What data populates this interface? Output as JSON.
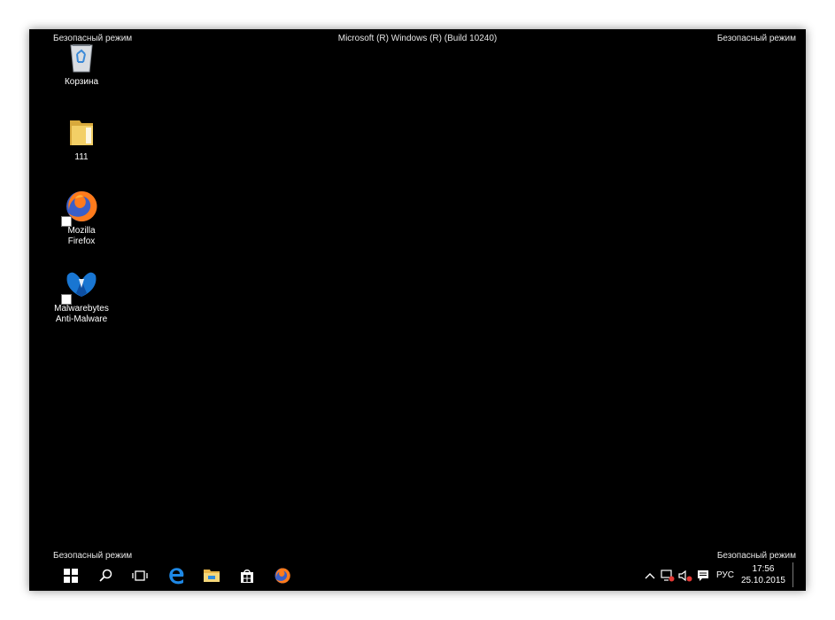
{
  "window": {
    "title": "Microsoft (R) Windows (R) (Build 10240)"
  },
  "safe_mode": {
    "label": "Безопасный режим"
  },
  "desktop_icons": [
    {
      "label": "Корзина",
      "icon": "recycle-bin-icon"
    },
    {
      "label": "111",
      "icon": "folder-icon"
    },
    {
      "label": "Mozilla\nFirefox",
      "icon": "firefox-icon",
      "shortcut": true
    },
    {
      "label": "Malwarebytes\nAnti-Malware",
      "icon": "malwarebytes-icon",
      "shortcut": true
    }
  ],
  "taskbar": {
    "icons": [
      "start-icon",
      "search-icon",
      "task-view-icon",
      "edge-icon",
      "file-explorer-icon",
      "store-icon",
      "firefox-icon"
    ],
    "tray": {
      "icons": [
        "chevron-up-icon",
        "network-icon",
        "volume-icon",
        "action-center-icon"
      ],
      "language": "РУС",
      "time": "17:56",
      "date": "25.10.2015"
    }
  },
  "colors": {
    "desktop": "#000000",
    "text": "#ffffff",
    "folder": "#e8c35a",
    "edge": "#1e88e5",
    "firefox": "#ff7b1c",
    "malwarebytes": "#1976d2"
  }
}
